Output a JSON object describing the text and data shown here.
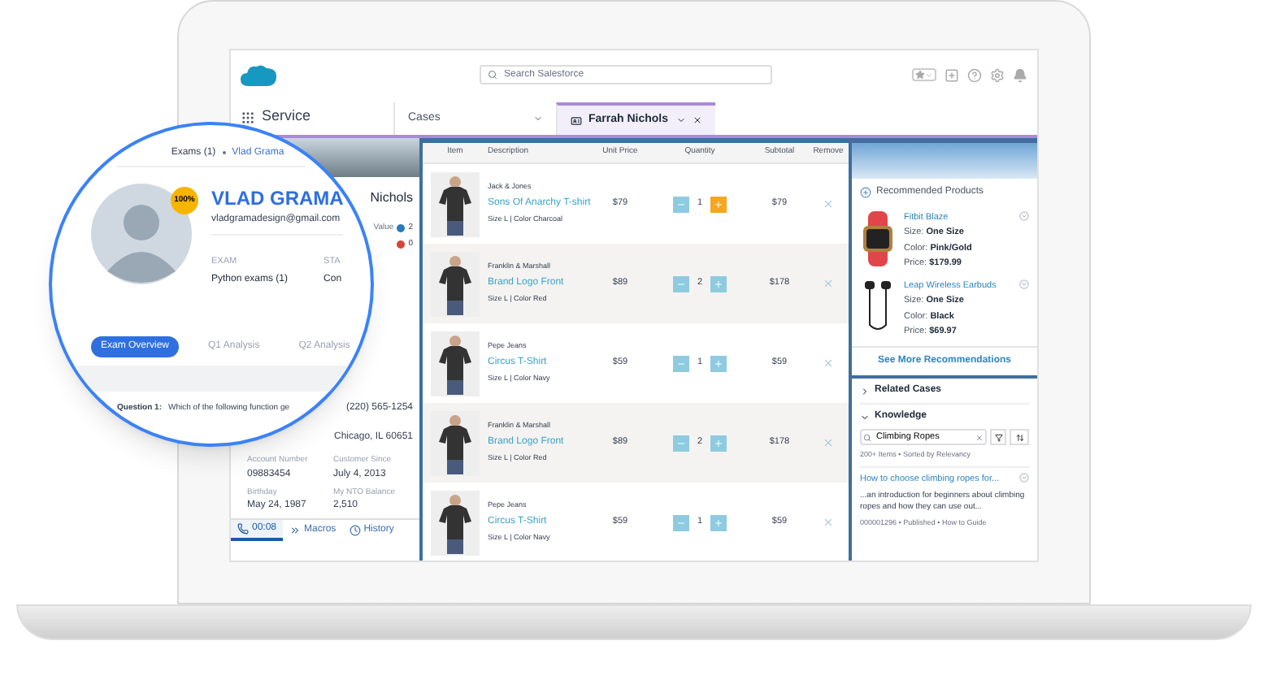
{
  "header": {
    "search": {
      "placeholder": "Search Salesforce"
    }
  },
  "nav": {
    "app_name": "Service",
    "tabs": [
      {
        "label": "Cases",
        "selected": false,
        "closable": false
      },
      {
        "label": "Farrah Nichols",
        "selected": true,
        "closable": true
      }
    ]
  },
  "contact_panel": {
    "name": "Nichols",
    "stats": [
      {
        "label": "Value",
        "value": "2",
        "color": "#2b7bb9"
      },
      {
        "value": "0",
        "color": "#d9433a"
      }
    ],
    "phone": "(220) 565-1254",
    "address": "Chicago, IL 60651",
    "fields": [
      {
        "label": "Account Number",
        "value": "09883454"
      },
      {
        "label": "Customer Since",
        "value": "July 4, 2013"
      },
      {
        "label": "Birthday",
        "value": "May 24, 1987"
      },
      {
        "label": "My NTO Balance",
        "value": "2,510"
      }
    ]
  },
  "utility_bar": [
    {
      "kind": "phone",
      "label": "00:08",
      "selected": true
    },
    {
      "kind": "macros",
      "label": "Macros",
      "selected": false
    },
    {
      "kind": "history",
      "label": "History",
      "selected": false
    }
  ],
  "magnifier": {
    "breadcrumb": [
      "Exams (1)",
      "Vlad Grama"
    ],
    "badge": "100%",
    "name": "VLAD GRAMA",
    "email": "vladgramadesign@gmail.com",
    "fields": [
      {
        "label": "EXAM",
        "value": "Python exams (1)"
      },
      {
        "label": "STA",
        "value": "Con"
      }
    ],
    "tabs": [
      {
        "label": "Exam Overview",
        "selected": true
      },
      {
        "label": "Q1 Analysis",
        "selected": false
      },
      {
        "label": "Q2 Analysis",
        "selected": false
      }
    ],
    "question": {
      "number": "Question 1:",
      "text": "Which of the following function ge"
    }
  },
  "cart": {
    "columns": [
      "Item",
      "Description",
      "Unit Price",
      "Quantity",
      "Subtotal",
      "Remove"
    ],
    "rows": [
      {
        "brand": "Jack & Jones",
        "name": "Sons Of Anarchy T-shirt",
        "details": "Size L | Color Charcoal",
        "unit_price": "$79",
        "quantity": "1",
        "subtotal": "$79",
        "plus_highlighted": true
      },
      {
        "brand": "Franklin & Marshall",
        "name": "Brand Logo Front",
        "details": "Size L | Color Red",
        "unit_price": "$89",
        "quantity": "2",
        "subtotal": "$178",
        "plus_highlighted": false
      },
      {
        "brand": "Pepe Jeans",
        "name": "Circus T-Shirt",
        "details": "Size L | Color Navy",
        "unit_price": "$59",
        "quantity": "1",
        "subtotal": "$59",
        "plus_highlighted": false
      },
      {
        "brand": "Franklin & Marshall",
        "name": "Brand Logo Front",
        "details": "Size L | Color Red",
        "unit_price": "$89",
        "quantity": "2",
        "subtotal": "$178",
        "plus_highlighted": false
      },
      {
        "brand": "Pepe Jeans",
        "name": "Circus T-Shirt",
        "details": "Size L | Color Navy",
        "unit_price": "$59",
        "quantity": "1",
        "subtotal": "$59",
        "plus_highlighted": false
      }
    ]
  },
  "recommendations": {
    "title": "Recommended Products",
    "products": [
      {
        "kind": "watch",
        "name": "Fitbit Blaze",
        "specs": [
          {
            "label": "Size:",
            "value": "One Size"
          },
          {
            "label": "Color:",
            "value": "Pink/Gold"
          },
          {
            "label": "Price:",
            "value": "$179.99"
          }
        ]
      },
      {
        "kind": "earbuds",
        "name": "Leap Wireless Earbuds",
        "specs": [
          {
            "label": "Size:",
            "value": "One Size"
          },
          {
            "label": "Color:",
            "value": "Black"
          },
          {
            "label": "Price:",
            "value": "$69.97"
          }
        ]
      }
    ],
    "more_link": "See More Recommendations"
  },
  "related_cases": {
    "title": "Related Cases",
    "expanded": false
  },
  "knowledge": {
    "title": "Knowledge",
    "expanded": true,
    "search": {
      "value": "Climbing Ropes"
    },
    "summary": "200+ Items • Sorted by Relevancy",
    "article": {
      "title": "How to choose climbing ropes for...",
      "snippet": "...an introduction for beginners about climbing ropes and how they can use out...",
      "meta": "000001296 • Published • How to Guide"
    }
  }
}
